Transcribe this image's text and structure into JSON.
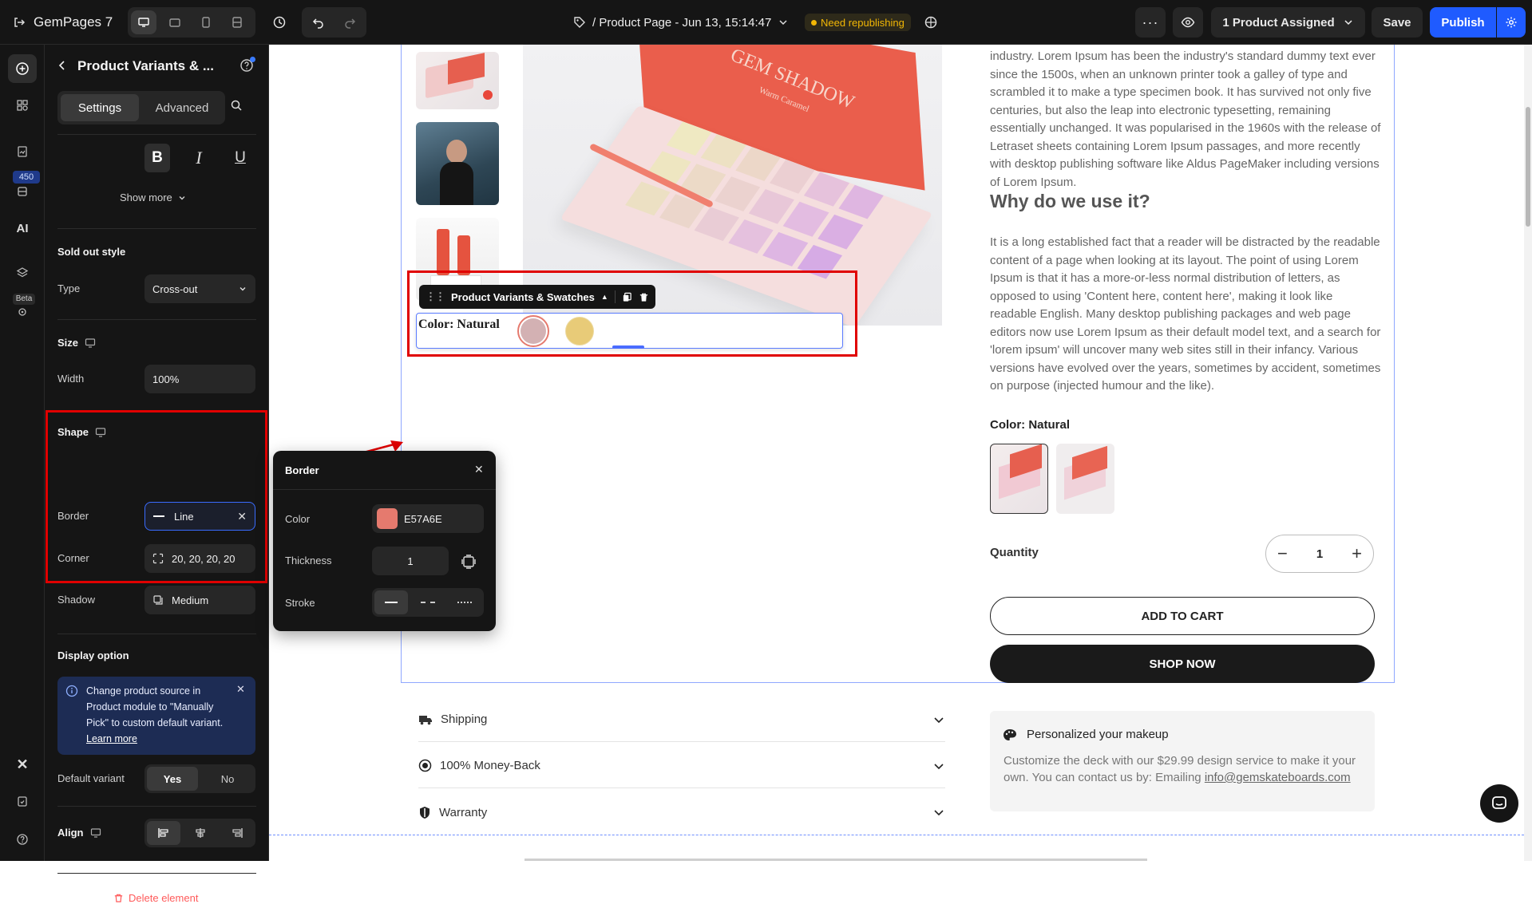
{
  "topbar": {
    "brand": "GemPages 7",
    "page_title": "/ Product Page - Jun 13, 15:14:47",
    "status_badge": "Need republishing",
    "assigned": "1 Product Assigned",
    "save": "Save",
    "publish": "Publish"
  },
  "rail": {
    "badge_count": "450",
    "beta": "Beta"
  },
  "panel": {
    "title": "Product Variants & ...",
    "tabs": [
      "Settings",
      "Advanced"
    ],
    "show_more": "Show more",
    "sold_out": {
      "heading": "Sold out style",
      "type_label": "Type",
      "type_value": "Cross-out"
    },
    "size": {
      "heading": "Size",
      "width_label": "Width",
      "width_value": "100%"
    },
    "shape": {
      "heading": "Shape",
      "border_label": "Border",
      "border_value": "Line",
      "corner_label": "Corner",
      "corner_value": "20, 20, 20, 20",
      "shadow_label": "Shadow",
      "shadow_value": "Medium"
    },
    "display": {
      "heading": "Display option",
      "info_text": "Change product source in Product module to \"Manually Pick\" to custom default variant.",
      "info_link": "Learn more",
      "default_variant_label": "Default variant",
      "yes": "Yes",
      "no": "No"
    },
    "align_label": "Align",
    "delete": "Delete element"
  },
  "border_popover": {
    "title": "Border",
    "color_label": "Color",
    "color_value": "E57A6E",
    "color_hex": "#E57A6E",
    "thickness_label": "Thickness",
    "thickness_value": "1",
    "stroke_label": "Stroke"
  },
  "canvas": {
    "selected_toolbar": "Product Variants & Swatches",
    "variant_label": "Color: Natural",
    "swatch_colors": [
      "#D3B1B3",
      "#E8CB78"
    ],
    "description_top": "industry. Lorem Ipsum has been the industry's standard dummy text ever since the 1500s, when an unknown printer took a galley of type and scrambled it to make a type specimen book. It has survived not only five centuries, but also the leap into electronic typesetting, remaining essentially unchanged. It was popularised in the 1960s with the release of Letraset sheets containing Lorem Ipsum passages, and more recently with desktop publishing software like Aldus PageMaker including versions of Lorem Ipsum.",
    "why_heading": "Why do we use it?",
    "why_text": "It is a long established fact that a reader will be distracted by the readable content of a page when looking at its layout. The point of using Lorem Ipsum is that it has a more-or-less normal distribution of letters, as opposed to using 'Content here, content here', making it look like readable English. Many desktop publishing packages and web page editors now use Lorem Ipsum as their default model text, and a search for 'lorem ipsum' will uncover many web sites still in their infancy. Various versions have evolved over the years, sometimes by accident, sometimes on purpose (injected humour and the like).",
    "color_label": "Color: Natural",
    "quantity_label": "Quantity",
    "quantity_value": "1",
    "add_to_cart": "ADD TO CART",
    "shop_now": "SHOP NOW",
    "accordion": [
      "Shipping",
      "100% Money-Back",
      "Warranty"
    ],
    "promo": {
      "title": "Personalized your makeup",
      "text": "Customize the deck with our $29.99 design service to make it your own. You can contact us by: Emailing",
      "email": "info@gemskateboards.com"
    },
    "palette_brand": "GEM SHADOW",
    "palette_sub": "Warm Caramel"
  },
  "colors": {
    "accent": "#1F5BFF",
    "highlight": "#E00000",
    "badge": "#F2B705",
    "dark": "#151515"
  }
}
